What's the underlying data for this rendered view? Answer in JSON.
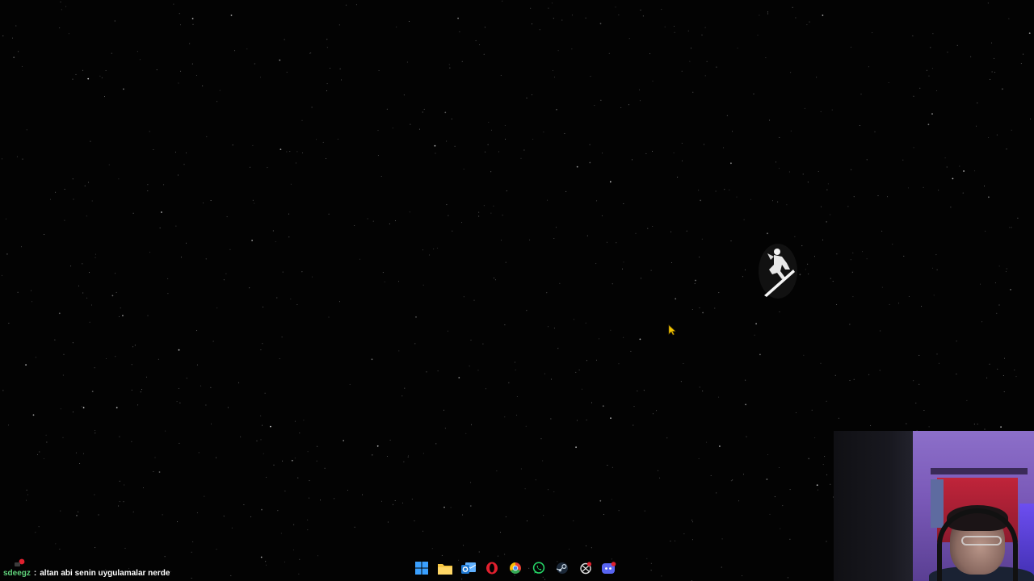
{
  "desktop": {
    "wallpaper": "starfield-with-silver-surfer",
    "background_color": "#030303"
  },
  "taskbar": {
    "icons": [
      {
        "name": "windows-start-icon",
        "color": "#3aa0ff"
      },
      {
        "name": "file-explorer-icon",
        "color": "#f5c542"
      },
      {
        "name": "outlook-mail-icon",
        "color": "#1f78d1"
      },
      {
        "name": "opera-browser-icon",
        "color": "#e0202e"
      },
      {
        "name": "chrome-browser-icon",
        "color": "#34a853"
      },
      {
        "name": "whatsapp-icon",
        "color": "#25d366"
      },
      {
        "name": "steam-icon",
        "color": "#c7d5e0"
      },
      {
        "name": "ring-app-icon",
        "color": "#e0e0e0"
      },
      {
        "name": "discord-icon",
        "color": "#5865f2"
      }
    ]
  },
  "chat": {
    "username": "sdeegz",
    "separator": ":",
    "message": "altan abi senin uygulamalar nerde",
    "username_color": "#5fd17a"
  },
  "webcam": {
    "label": "streamer-webcam"
  }
}
